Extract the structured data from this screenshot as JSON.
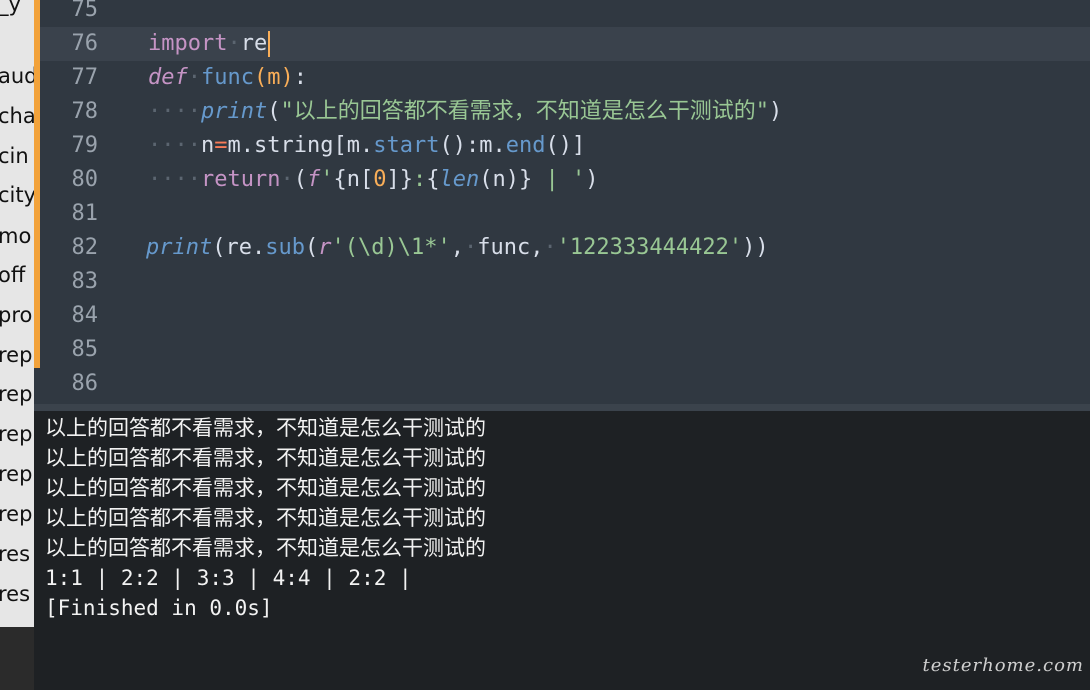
{
  "sidebar": {
    "items": [
      "_y",
      "aud",
      "cha",
      "cin",
      "city",
      "mo",
      "off",
      "pro",
      "rep",
      "rep",
      "rep",
      "rep",
      "rep",
      "res",
      "res"
    ]
  },
  "editor": {
    "lines": [
      {
        "n": "75"
      },
      {
        "n": "76"
      },
      {
        "n": "77"
      },
      {
        "n": "78"
      },
      {
        "n": "79"
      },
      {
        "n": "80"
      },
      {
        "n": "81"
      },
      {
        "n": "82"
      },
      {
        "n": "83"
      },
      {
        "n": "84"
      },
      {
        "n": "85"
      },
      {
        "n": "86"
      }
    ],
    "code": {
      "l76_import": "import",
      "l76_mod": "re",
      "l77_def": "def",
      "l77_name": "func",
      "l77_arg": "m",
      "l78_print": "print",
      "l78_str": "\"以上的回答都不看需求，不知道是怎么干测试的\"",
      "l79_n": "n",
      "l79_m": "m",
      "l79_string": "string",
      "l79_m2": "m",
      "l79_start": "start",
      "l79_m3": "m",
      "l79_end": "end",
      "l80_return": "return",
      "l80_f": "f",
      "l80_q1": "'",
      "l80_n": "n",
      "l80_zero": "0",
      "l80_len": "len",
      "l80_n2": "n",
      "l80_bar": " | ",
      "l80_q2": "'",
      "l82_print": "print",
      "l82_re": "re",
      "l82_sub": "sub",
      "l82_r": "r",
      "l82_pattern": "'(\\d)\\1*'",
      "l82_func": "func",
      "l82_arg": "'122333444422'"
    }
  },
  "output": {
    "lines": [
      "以上的回答都不看需求，不知道是怎么干测试的",
      "以上的回答都不看需求，不知道是怎么干测试的",
      "以上的回答都不看需求，不知道是怎么干测试的",
      "以上的回答都不看需求，不知道是怎么干测试的",
      "以上的回答都不看需求，不知道是怎么干测试的",
      "1:1 | 2:2 | 3:3 | 4:4 | 2:2 |",
      "[Finished in 0.0s]"
    ]
  },
  "watermark": "testerhome.com"
}
